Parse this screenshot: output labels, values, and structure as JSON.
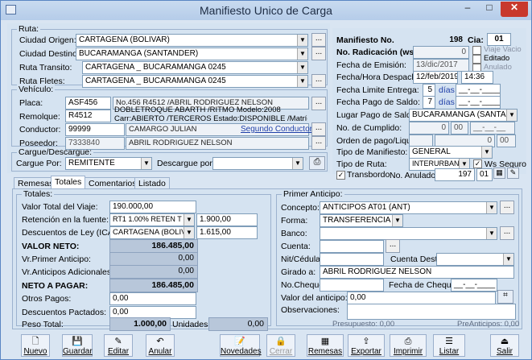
{
  "window": {
    "title": "Manifiesto Unico de Carga",
    "minimize": "–",
    "maximize": "□",
    "close": "✕"
  },
  "ruta": {
    "legend": "Ruta:",
    "origen_label": "Ciudad Origen:",
    "origen": "CARTAGENA  (BOLIVAR)",
    "destino_label": "Ciudad Destino:",
    "destino": "BUCARAMANGA  (SANTANDER)",
    "transito_label": "Ruta Transito:",
    "transito": "CARTAGENA _ BUCARAMANGA 0245",
    "fletes_label": "Ruta Fletes:",
    "fletes": "CARTAGENA _ BUCARAMANGA 0245",
    "dots": "..."
  },
  "vehiculo": {
    "legend": "Vehículo:",
    "placa_label": "Placa:",
    "placa": "ASF456",
    "placa_desc": "No.456 R4512 /ABRIL RODRIGUEZ NELSON",
    "remolque_label": "Remolque:",
    "remolque": "R4512",
    "remolque_desc1": "DOBLETROQUE ABARTH /RITMO Modelo:2008",
    "remolque_desc2": "Carr:ABIERTO /TERCEROS Estado:DISPONIBLE /Matrícula:",
    "conductor_label": "Conductor:",
    "conductor": "99999",
    "conductor_name": "CAMARGO JULIAN",
    "segundo": "Segundo Conductor...",
    "poseedor_label": "Poseedor:",
    "poseedor": "7333840",
    "poseedor_name": "ABRIL RODRIGUEZ NELSON"
  },
  "cargue": {
    "legend": "Cargue/Descargue:",
    "por_label": "Cargue Por:",
    "por": "REMITENTE",
    "desc_label": "Descargue por:",
    "desc": ""
  },
  "manifiesto": {
    "no_label": "Manifiesto No.",
    "no": "198",
    "cia_label": "Cia:",
    "cia": "01",
    "rad_label": "No. Radicación (ws):",
    "rad": "0",
    "viaje_vacio": "Viaje Vacio",
    "editado": "Editado",
    "anulado": "Anulado",
    "emision_label": "Fecha de Emisión:",
    "emision": "13/dic/2017",
    "despacho_label": "Fecha/Hora Despacho:",
    "despacho_fecha": "12/feb/2019",
    "despacho_hora": "14:36",
    "limite_label": "Fecha Limite Entrega:",
    "limite_n": "5",
    "dias": "días",
    "limite_fecha": "__-__-____",
    "pago_label": "Fecha Pago de Saldo:",
    "pago_n": "7",
    "pago_fecha": "__-__-____",
    "lugar_label": "Lugar Pago de Saldo:",
    "lugar": "BUCARAMANGA  (SANTAND",
    "cumplido_label": "No. de Cumplido:",
    "cumplido_a": "0",
    "cumplido_b": "00",
    "cumplido_fecha": "__-__-__",
    "orden_label": "Orden de pago/Liquida:",
    "orden_a": "0",
    "orden_b": "00",
    "tipo_label": "Tipo de Manifiesto:",
    "tipo": "GENERAL",
    "tiporuta_label": "Tipo de Ruta:",
    "tiporuta": "INTERURBANO",
    "ws_seguro": "Ws Seguro",
    "transbordo": "Transbordo",
    "anulado_label": "No. Anulado:",
    "anulado_no": "197",
    "anulado_cia": "01"
  },
  "tabs": [
    "Remesas",
    "Totales",
    "Comentarios",
    "Listado"
  ],
  "totales": {
    "legend": "Totales:",
    "valor_label": "Valor Total del Viaje:",
    "valor": "190.000,00",
    "ret_label": "Retención en la fuente:",
    "ret_sel": "RT1  1.00% RETEN T",
    "ret_val": "1.900,00",
    "desc_label": "Descuentos de Ley (ICA):",
    "desc_sel": "CARTAGENA  (BOLIVA",
    "desc_val": "1.615,00",
    "neto_label": "VALOR NETO:",
    "neto": "186.485,00",
    "primer_label": "Vr.Primer Anticipo:",
    "primer": "0,00",
    "adic_label": "Vr.Anticipos Adicionales:",
    "adic": "0,00",
    "pagar_label": "NETO A PAGAR:",
    "pagar": "186.485,00",
    "otros_label": "Otros Pagos:",
    "otros": "0,00",
    "pactados_label": "Descuentos Pactados:",
    "pactados": "0,00",
    "peso_label": "Peso Total:",
    "peso": "1.000,00",
    "unidades_label": "Unidades:",
    "unidades": "0,00"
  },
  "anticipo": {
    "legend": "Primer Anticipo:",
    "concepto_label": "Concepto:",
    "concepto": "ANTICIPOS AT01  (ANT)",
    "forma_label": "Forma:",
    "forma": "TRANSFERENCIA",
    "banco_label": "Banco:",
    "cuenta_label": "Cuenta:",
    "nit_label": "Nit/Cédula:",
    "cuenta_destino_label": "Cuenta Destino:",
    "girado_label": "Girado a:",
    "girado": "ABRIL RODRIGUEZ NELSON",
    "cheque_label": "No.Cheque:",
    "fecha_cheque_label": "Fecha de Cheque:",
    "fecha_cheque": "__-__-____",
    "valor_label": "Valor del anticipo:",
    "valor": "0,00",
    "obs_label": "Observaciones:",
    "presupuesto": "Presupuesto: 0,00",
    "preanticipos": "PreAnticipos: 0,00"
  },
  "toolbar": [
    "Nuevo",
    "Guardar",
    "Editar",
    "Anular",
    "Novedades",
    "Cerrar",
    "Remesas",
    "Exportar",
    "Imprimir",
    "Listar",
    "Salir"
  ],
  "colors": {
    "title_bg": "#c9dbf0",
    "panel": "#d5e3f1",
    "close": "#c8392d",
    "link": "#1f3fa8"
  }
}
